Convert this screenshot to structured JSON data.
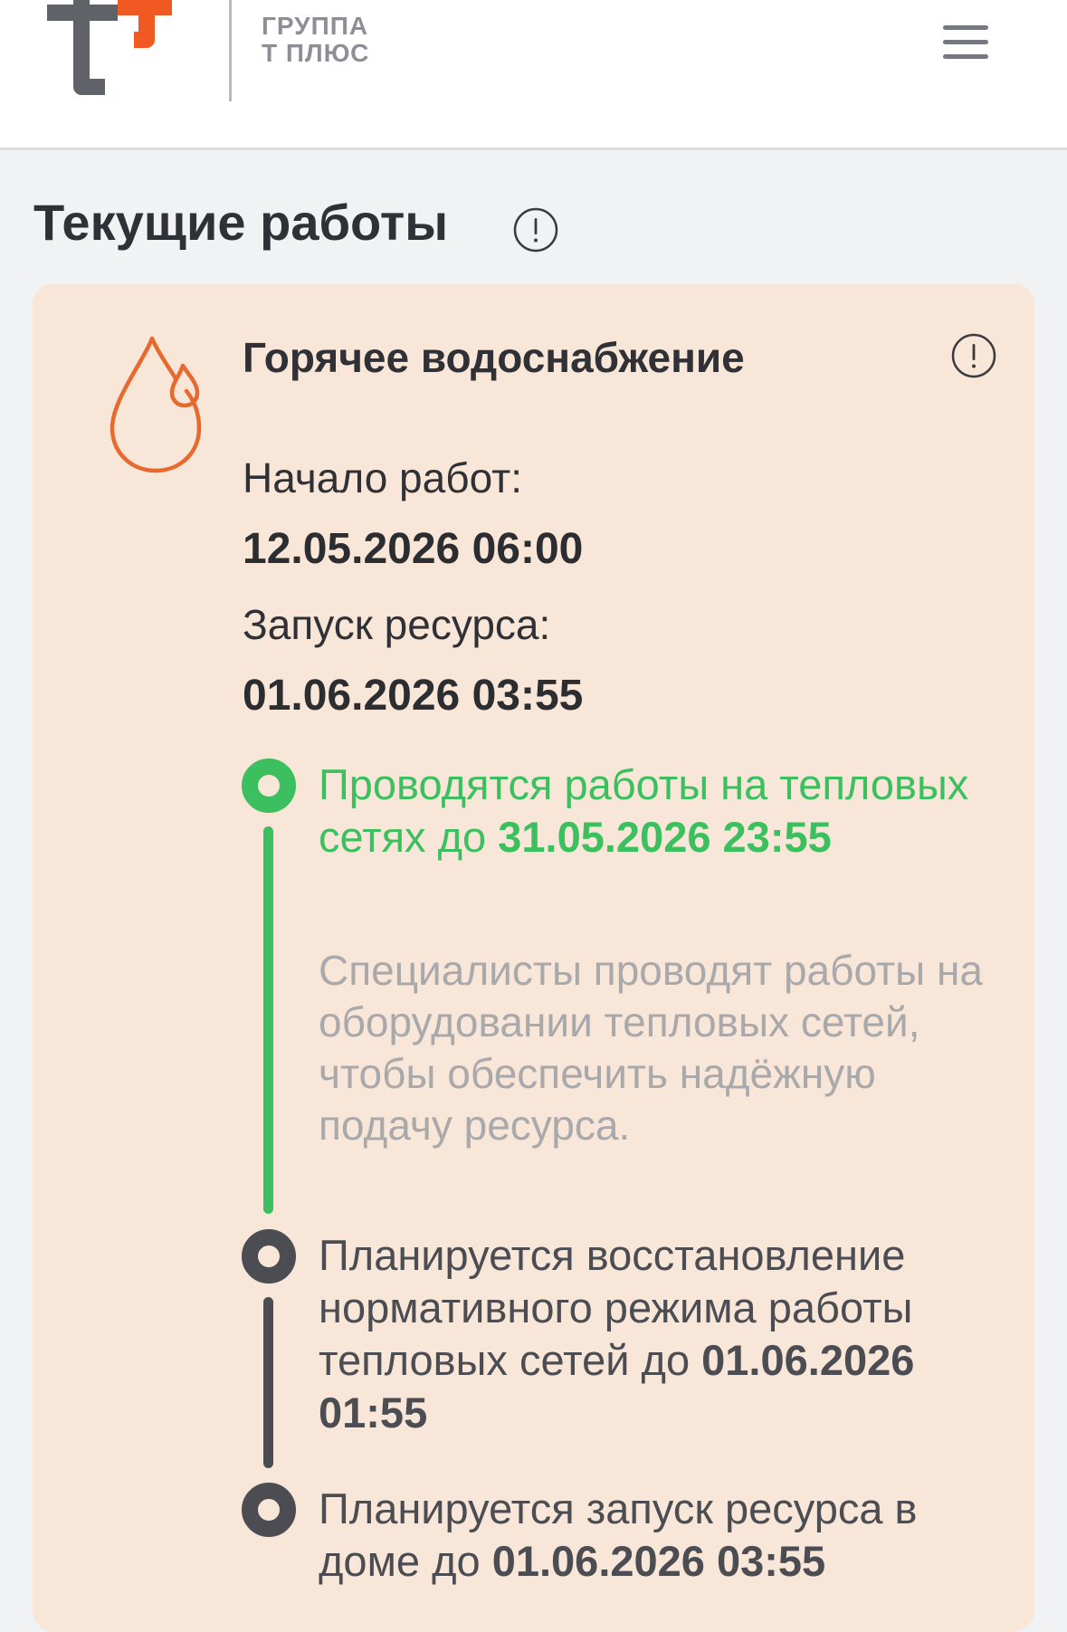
{
  "header": {
    "brand_line1": "Группа",
    "brand_line2": "Т Плюс",
    "logo_colors": {
      "gray": "#5f6368",
      "orange": "#f05a22"
    },
    "menu_icon": "hamburger-icon"
  },
  "page": {
    "title": "Текущие работы",
    "info_icon": "info-circle-icon"
  },
  "card": {
    "background": "#f8e6d9",
    "icon": "water-drop-icon",
    "icon_color": "#e8682d",
    "title": "Горячее водоснабжение",
    "start_label": "Начало работ:",
    "start_value": "12.05.2026 06:00",
    "launch_label": "Запуск ресурса:",
    "launch_value": "01.06.2026 03:55",
    "steps": [
      {
        "state": "active",
        "color": "#3cc05f",
        "text": "Проводятся работы на тепловых сетях до",
        "date": "31.05.2026 23:55",
        "description": "Специалисты проводят работы на оборудовании тепловых сетей, чтобы обеспечить надёжную подачу ресурса."
      },
      {
        "state": "planned",
        "color": "#4c4d52",
        "text": "Планируется восстановление нормативного режима работы тепловых сетей до",
        "date": "01.06.2026 01:55"
      },
      {
        "state": "planned",
        "color": "#4c4d52",
        "text": "Планируется запуск ресурса в доме до",
        "date": "01.06.2026 03:55"
      }
    ]
  }
}
